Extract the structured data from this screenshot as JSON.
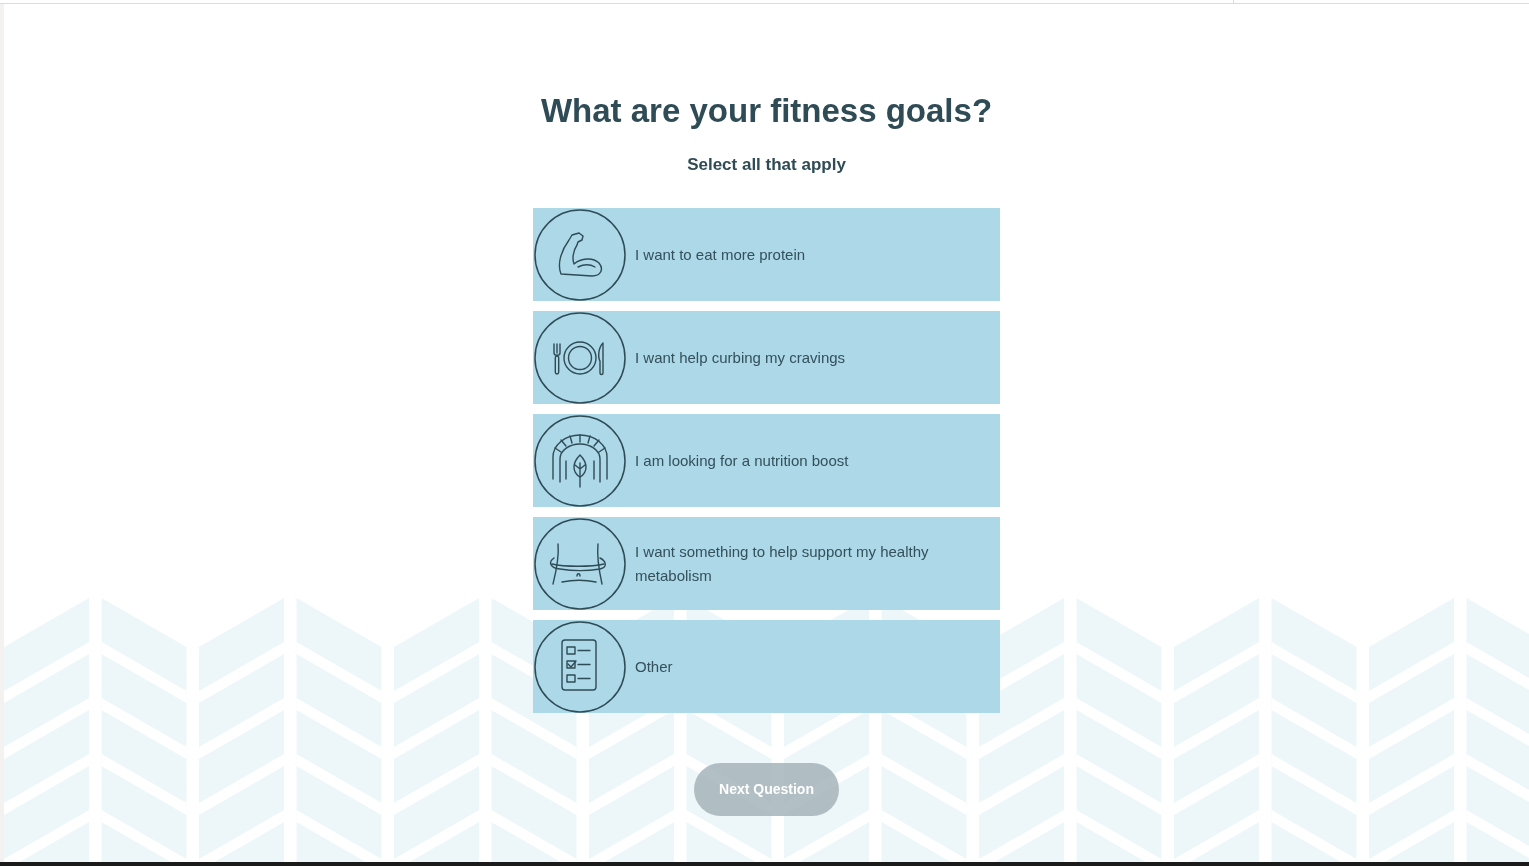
{
  "question": {
    "title": "What are your fitness goals?",
    "subtitle": "Select all that apply"
  },
  "options": [
    {
      "label": "I want to eat more protein",
      "selected": false
    },
    {
      "label": "I want help curbing my cravings",
      "selected": false
    },
    {
      "label": "I am looking for a nutrition boost",
      "selected": false
    },
    {
      "label": "I want something to help support my healthy metabolism",
      "selected": false
    },
    {
      "label": "Other",
      "selected": false
    }
  ],
  "next_button": {
    "label": "Next Question",
    "disabled": true
  }
}
